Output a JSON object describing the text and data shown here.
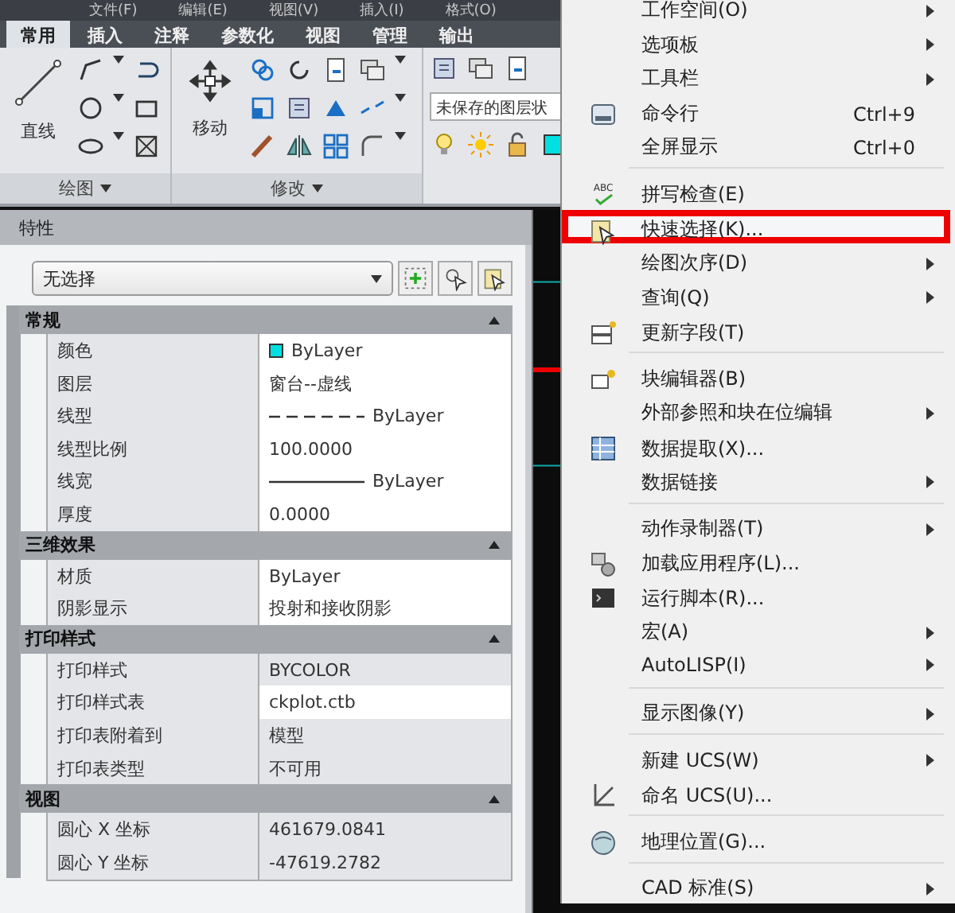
{
  "menu_bar": [
    "文件(F)",
    "编辑(E)",
    "视图(V)",
    "插入(I)",
    "格式(O)"
  ],
  "ribbon": {
    "tabs": [
      {
        "label": "常用",
        "selected": true
      },
      {
        "label": "插入",
        "selected": false
      },
      {
        "label": "注释",
        "selected": false
      },
      {
        "label": "参数化",
        "selected": false
      },
      {
        "label": "视图",
        "selected": false
      },
      {
        "label": "管理",
        "selected": false
      },
      {
        "label": "输出",
        "selected": false
      }
    ],
    "draw_panel": {
      "title": "绘图",
      "big_tool": "直线"
    },
    "modify_panel": {
      "title": "修改",
      "big_tool": "移动"
    },
    "layer_panel": {
      "layer_state": "未保存的图层状"
    }
  },
  "properties": {
    "title": "特性",
    "selection": "无选择",
    "sections": [
      {
        "title": "常规",
        "expanded": true,
        "rows": [
          {
            "label": "颜色",
            "value": "ByLayer",
            "kind": "swatch",
            "color": "#00e0e0",
            "editable": true
          },
          {
            "label": "图层",
            "value": "窗台--虚线",
            "kind": "text",
            "editable": true
          },
          {
            "label": "线型",
            "value": "ByLayer",
            "kind": "dashed",
            "editable": true
          },
          {
            "label": "线型比例",
            "value": "100.0000",
            "kind": "text",
            "editable": true
          },
          {
            "label": "线宽",
            "value": "ByLayer",
            "kind": "solid",
            "editable": true
          },
          {
            "label": "厚度",
            "value": "0.0000",
            "kind": "text",
            "editable": true
          }
        ]
      },
      {
        "title": "三维效果",
        "expanded": true,
        "rows": [
          {
            "label": "材质",
            "value": "ByLayer",
            "kind": "text",
            "editable": true
          },
          {
            "label": "阴影显示",
            "value": "投射和接收阴影",
            "kind": "text",
            "editable": true
          }
        ]
      },
      {
        "title": "打印样式",
        "expanded": true,
        "rows": [
          {
            "label": "打印样式",
            "value": "BYCOLOR",
            "kind": "text",
            "editable": false
          },
          {
            "label": "打印样式表",
            "value": "ckplot.ctb",
            "kind": "text",
            "editable": true
          },
          {
            "label": "打印表附着到",
            "value": "模型",
            "kind": "text",
            "editable": false
          },
          {
            "label": "打印表类型",
            "value": "不可用",
            "kind": "text",
            "editable": false
          }
        ]
      },
      {
        "title": "视图",
        "expanded": true,
        "rows": [
          {
            "label": "圆心 X 坐标",
            "value": "461679.0841",
            "kind": "text",
            "editable": false
          },
          {
            "label": "圆心 Y 坐标",
            "value": "-47619.2782",
            "kind": "text",
            "editable": false
          }
        ]
      }
    ]
  },
  "context_menu": {
    "groups": [
      [
        {
          "label": "工作空间(O)",
          "submenu": true,
          "highlighted": false
        },
        {
          "label": "选项板",
          "submenu": true,
          "highlighted": false
        },
        {
          "label": "工具栏",
          "submenu": true,
          "highlighted": false
        },
        {
          "label": "命令行",
          "shortcut": "Ctrl+9",
          "submenu": false,
          "highlighted": false
        },
        {
          "label": "全屏显示",
          "shortcut": "Ctrl+0",
          "submenu": false,
          "highlighted": false
        }
      ],
      [
        {
          "label": "拼写检查(E)",
          "icon_text": "ABC",
          "submenu": false,
          "highlighted": false
        },
        {
          "label": "快速选择(K)...",
          "submenu": false,
          "highlighted": true
        },
        {
          "label": "绘图次序(D)",
          "submenu": true,
          "highlighted": false
        },
        {
          "label": "查询(Q)",
          "submenu": true,
          "highlighted": false
        },
        {
          "label": "更新字段(T)",
          "submenu": false,
          "highlighted": false
        }
      ],
      [
        {
          "label": "块编辑器(B)",
          "submenu": false,
          "highlighted": false
        },
        {
          "label": "外部参照和块在位编辑",
          "submenu": true,
          "highlighted": false
        },
        {
          "label": "数据提取(X)...",
          "submenu": false,
          "highlighted": false
        },
        {
          "label": "数据链接",
          "submenu": true,
          "highlighted": false
        }
      ],
      [
        {
          "label": "动作录制器(T)",
          "submenu": true,
          "highlighted": false
        },
        {
          "label": "加载应用程序(L)...",
          "submenu": false,
          "highlighted": false
        },
        {
          "label": "运行脚本(R)...",
          "submenu": false,
          "highlighted": false
        },
        {
          "label": "宏(A)",
          "submenu": true,
          "highlighted": false
        },
        {
          "label": "AutoLISP(I)",
          "submenu": true,
          "highlighted": false
        }
      ],
      [
        {
          "label": "显示图像(Y)",
          "submenu": true,
          "highlighted": false
        }
      ],
      [
        {
          "label": "新建 UCS(W)",
          "submenu": true,
          "highlighted": false
        },
        {
          "label": "命名 UCS(U)...",
          "submenu": false,
          "highlighted": false
        }
      ],
      [
        {
          "label": "地理位置(G)...",
          "submenu": false,
          "highlighted": false
        }
      ],
      [
        {
          "label": "CAD 标准(S)",
          "submenu": true,
          "highlighted": false
        }
      ]
    ]
  }
}
